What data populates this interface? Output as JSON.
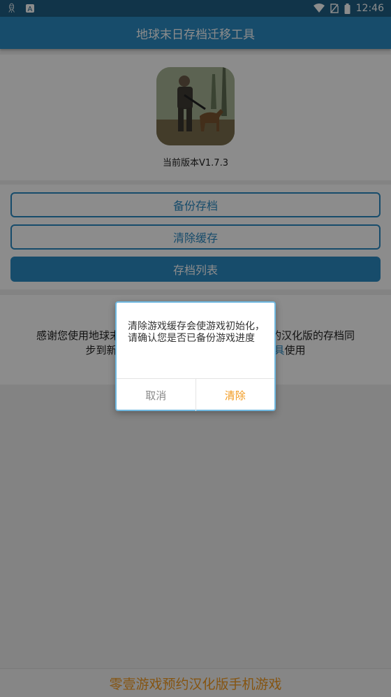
{
  "status_bar": {
    "time": "12:46",
    "left_icons": [
      "bug-icon",
      "a-notification-icon"
    ],
    "right_icons": [
      "wifi-icon",
      "no-sim-icon",
      "battery-icon"
    ]
  },
  "app_bar": {
    "title": "地球末日存档迁移工具"
  },
  "app_info": {
    "version": "当前版本V1.7.3"
  },
  "buttons": {
    "backup": "备份存档",
    "clear_cache": "清除缓存",
    "save_list": "存档列表"
  },
  "info_text": {
    "part1": "感谢您使用地球末日",
    "part2": "版的汉化版的存档同",
    "part3": "步到新版的。",
    "link": "份工具",
    "part4": "使用"
  },
  "dialog": {
    "message": "清除游戏缓存会使游戏初始化，请确认您是否已备份游戏进度",
    "cancel_label": "取消",
    "confirm_label": "清除"
  },
  "footer": {
    "text": "零壹游戏预约汉化版手机游戏"
  },
  "colors": {
    "primary": "#2b8ac4",
    "status_bar": "#1f5f85",
    "accent": "#f29a1f"
  }
}
